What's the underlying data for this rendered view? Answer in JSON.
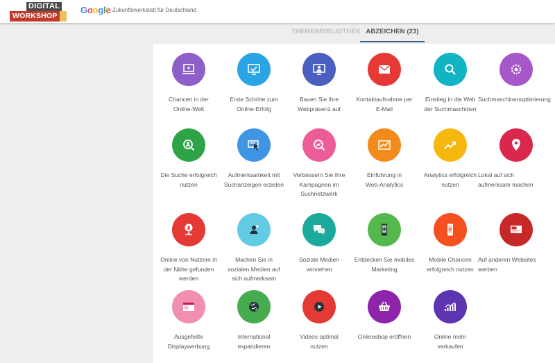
{
  "header": {
    "logo_top": "DIGITAL",
    "logo_bottom": "WORKSHOP",
    "google": [
      "G",
      "o",
      "o",
      "g",
      "l",
      "e"
    ],
    "tagline": "Zukunftswerkstatt für Deutschland"
  },
  "tabs": [
    {
      "label": "THEMENBIBLIOTHEK",
      "active": false
    },
    {
      "label": "ABZEICHEN (23)",
      "active": true
    }
  ],
  "badges": [
    {
      "label": "Chancen in der\nOnline-Welt",
      "color": "#8e5fc9",
      "icon": "laptop-icon"
    },
    {
      "label": "Erste Schritte zum\nOnline-Erfolg",
      "color": "#2aa4e4",
      "icon": "monitor-check-icon"
    },
    {
      "label": "Bauen Sie Ihre\nWebpräsenz auf",
      "color": "#4b5fc0",
      "icon": "monitor-user-icon"
    },
    {
      "label": "Kontaktaufnahme per\nE-Mail",
      "color": "#e53935",
      "icon": "envelope-icon"
    },
    {
      "label": "Einstieg in die Welt\nder Suchmaschinen",
      "color": "#12b4c4",
      "icon": "magnifier-icon"
    },
    {
      "label": "Suchmaschinenoptimierung",
      "color": "#a758c8",
      "icon": "gear-search-icon"
    },
    {
      "label": "Die Suche erfolgreich\nnutzen",
      "color": "#2fa447",
      "icon": "search-person-icon"
    },
    {
      "label": "Aufmerksamkeit mit\nSuchanzeigen erzielen",
      "color": "#3f95e4",
      "icon": "cursor-ad-icon"
    },
    {
      "label": "Verbessern Sie Ihre\nKampagnen im\nSuchnetzwerk",
      "color": "#ec5d97",
      "icon": "chart-magnifier-icon"
    },
    {
      "label": "Einführung in\nWeb-Analytics",
      "color": "#f18c1c",
      "icon": "trend-chart-icon"
    },
    {
      "label": "Analytics erfolgreich\nnutzen",
      "color": "#f6b70e",
      "icon": "trend-up-icon"
    },
    {
      "label": "Lokal auf sich\naufmerksam machen",
      "color": "#d9274d",
      "icon": "location-pin-icon"
    },
    {
      "label": "Online von Nutzern in\nder Nähe gefunden\nwerden",
      "color": "#e53935",
      "icon": "pin-person-icon"
    },
    {
      "label": "Machen Sie in\nsozialen Medien auf\nsich aufmerksam",
      "color": "#63cce4",
      "icon": "add-user-icon"
    },
    {
      "label": "Soziale Medien\nverstehen",
      "color": "#1aa99a",
      "icon": "chat-bubbles-icon"
    },
    {
      "label": "Entdecken Sie mobiles\nMarketing",
      "color": "#55b84c",
      "icon": "smartphone-plus-icon"
    },
    {
      "label": "Mobile Chancen\nerfolgreich nutzen",
      "color": "#f4511e",
      "icon": "smartphone-check-icon"
    },
    {
      "label": "Auf anderen Websites\nwerben",
      "color": "#c62828",
      "icon": "display-ad-icon"
    },
    {
      "label": "Ausgefeilte\nDisplaywerbung",
      "color": "#f08fb0",
      "icon": "display-banner-icon"
    },
    {
      "label": "International\nexpandieren",
      "color": "#46ac4f",
      "icon": "globe-icon"
    },
    {
      "label": "Videos optimal\nnutzen",
      "color": "#e53935",
      "icon": "play-button-icon"
    },
    {
      "label": "Onlineshop eröffnen",
      "color": "#8e24aa",
      "icon": "shopping-basket-icon"
    },
    {
      "label": "Online mehr\nverkaufen",
      "color": "#5e35b1",
      "icon": "bar-growth-icon"
    }
  ]
}
